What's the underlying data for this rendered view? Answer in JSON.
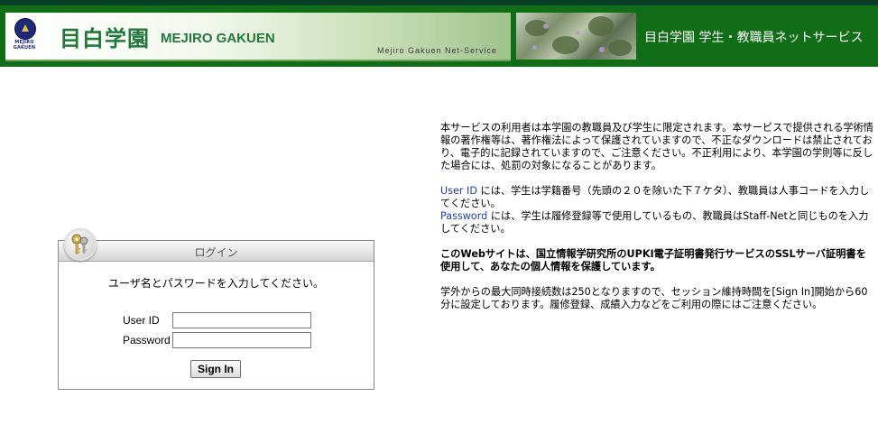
{
  "header": {
    "logo_text": "MEJIRO GAKUEN",
    "brand_jp": "目白学園",
    "brand_en": "MEJIRO GAKUEN",
    "net_service": "Mejiro Gakuen   Net-Service",
    "service_title": "目白学園 学生・教職員ネットサービス"
  },
  "login": {
    "title": "ログイン",
    "instruction": "ユーザ名とパスワードを入力してください。",
    "userid_label": "User ID",
    "password_label": "Password",
    "userid_value": "",
    "password_value": "",
    "signin_label": "Sign In"
  },
  "info": {
    "p1": "本サービスの利用者は本学園の教職員及び学生に限定されます。本サービスで提供される学術情報の著作権等は、著作権法によって保護されていますので、不正なダウンロードは禁止されており、電子的に記録されていますので、ご注意ください。不正利用により、本学園の学則等に反した場合には、処罰の対象になることがあります。",
    "userid_term": "User ID",
    "userid_text": " には、学生は学籍番号（先頭の２０を除いた下７ケタ）、教職員は人事コードを入力してください。",
    "password_term": "Password",
    "password_text": " には、学生は履修登録等で使用しているもの、教職員はStaff-Netと同じものを入力してください。",
    "ssl_notice": "このWebサイトは、国立情報学研究所のUPKI電子証明書発行サービスのSSLサーバ証明書を使用して、あなたの個人情報を保護しています。",
    "session_notice": "学外からの最大同時接続数は250となりますので、セッション維持時間を[Sign In]開始から60分に設定しております。履修登録、成績入力などをご利用の際にはご注意ください。"
  },
  "colors": {
    "header_green": "#0f6e16",
    "brand_green": "#1f7a3a",
    "link_blue": "#1a3fcc"
  }
}
